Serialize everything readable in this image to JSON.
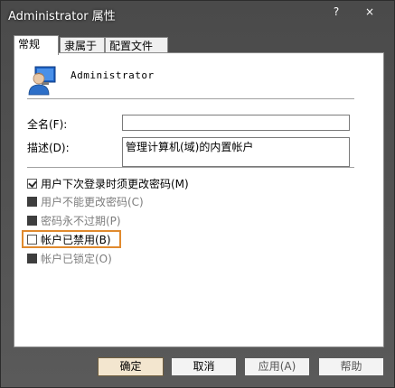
{
  "window": {
    "title": "Administrator 属性",
    "help_glyph": "?",
    "close_glyph": "×"
  },
  "tabs": [
    {
      "label": "常规",
      "active": true
    },
    {
      "label": "隶属于",
      "active": false
    },
    {
      "label": "配置文件",
      "active": false
    }
  ],
  "general": {
    "username": "Administrator",
    "fullname_label": "全名(F):",
    "fullname_value": "",
    "description_label": "描述(D):",
    "description_value": "管理计算机(域)的内置帐户"
  },
  "options": [
    {
      "label": "用户下次登录时须更改密码(M)",
      "state": "checked",
      "enabled": true
    },
    {
      "label": "用户不能更改密码(C)",
      "state": "filled",
      "enabled": false
    },
    {
      "label": "密码永不过期(P)",
      "state": "filled",
      "enabled": false
    },
    {
      "label": "帐户已禁用(B)",
      "state": "unchecked",
      "enabled": true
    },
    {
      "label": "帐户已锁定(O)",
      "state": "filled",
      "enabled": false
    }
  ],
  "buttons": {
    "ok": "确定",
    "cancel": "取消",
    "apply": "应用(A)",
    "help": "帮助"
  },
  "colors": {
    "highlight": "#e08a2e",
    "frame": "#4a4a4a"
  }
}
